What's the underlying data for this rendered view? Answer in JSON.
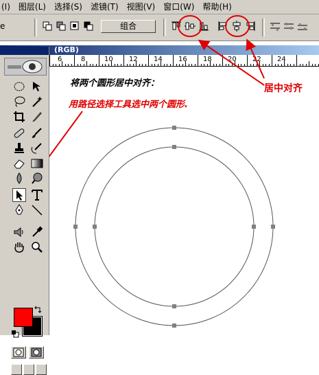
{
  "menu": [
    "(I)",
    "图层(L)",
    "选择(S)",
    "滤镜(T)",
    "视图(V)",
    "窗口(W)",
    "帮助(H)"
  ],
  "options": {
    "left_label": "e",
    "combine_label": "组合"
  },
  "document": {
    "title_suffix": "(RGB)"
  },
  "ruler": {
    "labels": [
      "6",
      "8",
      "10",
      "12",
      "14",
      "16",
      "18",
      "20",
      "22",
      "24"
    ]
  },
  "canvas": {
    "instruction": "将两个圆形居中对齐：",
    "step": "用路径选择工具选中两个圆形."
  },
  "callout": {
    "label": "居中对齐"
  },
  "colors": {
    "foreground": "#ff0000",
    "background": "#000000",
    "annotation": "#e00000"
  }
}
